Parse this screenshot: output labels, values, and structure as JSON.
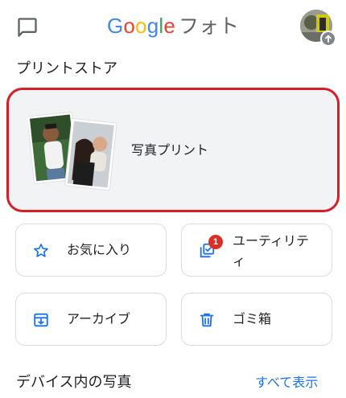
{
  "header": {
    "brand_google": [
      "G",
      "o",
      "o",
      "g",
      "l",
      "e"
    ],
    "brand_colors": [
      "#4285f4",
      "#ea4335",
      "#fbbc05",
      "#4285f4",
      "#34a853",
      "#ea4335"
    ],
    "brand_product": "フォト",
    "chat_icon": "chat-bubble-icon",
    "avatar_badge_icon": "upload-arrow-icon"
  },
  "print_store": {
    "title": "プリントストア",
    "card_label": "写真プリント",
    "highlight_color": "#d61f26"
  },
  "tiles": [
    {
      "label": "お気に入り",
      "icon": "star-outline-icon"
    },
    {
      "label": "ユーティリティ",
      "icon": "utilities-icon",
      "badge": "1"
    },
    {
      "label": "アーカイブ",
      "icon": "archive-icon"
    },
    {
      "label": "ゴミ箱",
      "icon": "trash-icon"
    }
  ],
  "device_section": {
    "title": "デバイス内の写真",
    "see_all": "すべて表示"
  },
  "accent_color": "#1a73e8"
}
